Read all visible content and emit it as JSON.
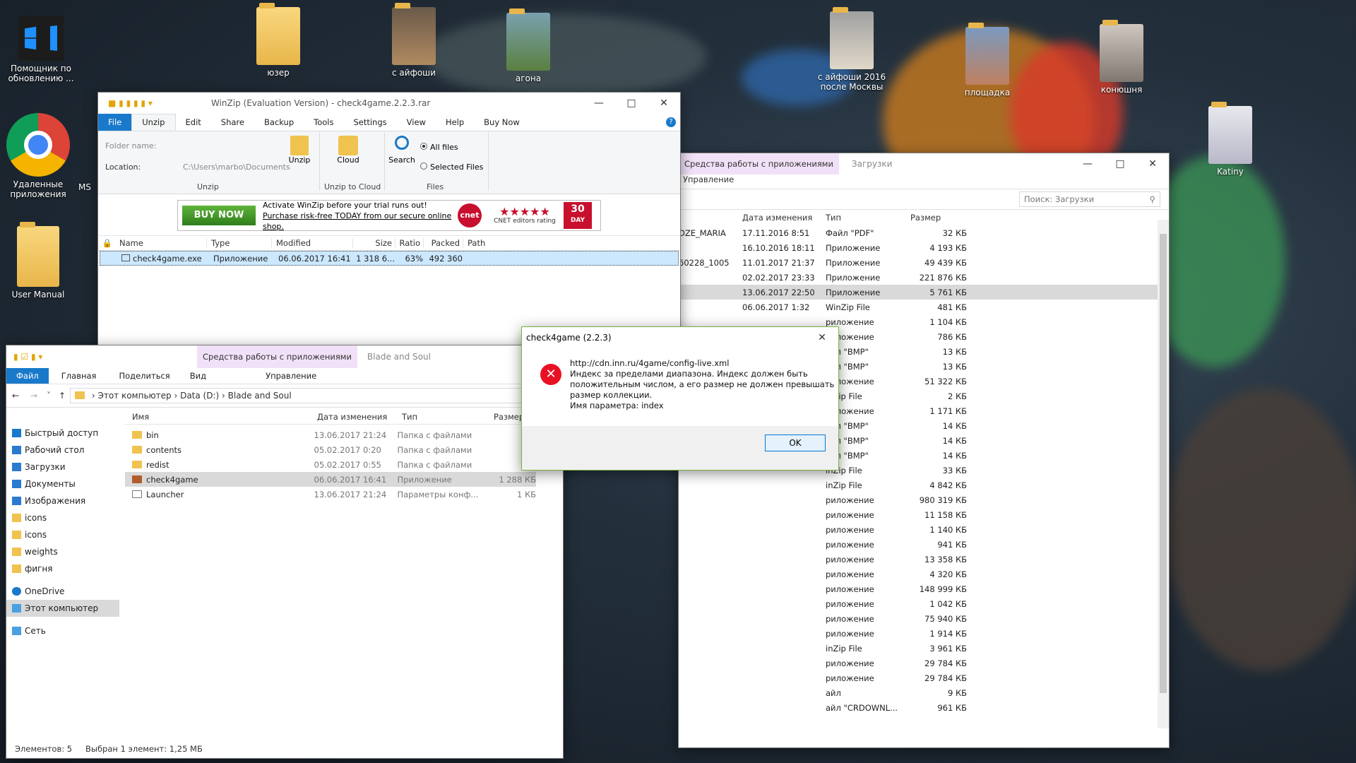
{
  "desktop": {
    "icons": [
      {
        "label": "Помощник по обновлению ...",
        "name": "update-assistant-icon"
      },
      {
        "label": "Удаленные приложения",
        "name": "chrome-icon"
      },
      {
        "label": "MS",
        "name": "ms-icon"
      },
      {
        "label": "User Manual",
        "name": "user-manual-icon"
      },
      {
        "label": "юзер",
        "name": "folder-user-icon"
      },
      {
        "label": "с айфоши",
        "name": "folder-iphone-icon"
      },
      {
        "label": "агона",
        "name": "folder-agona-icon"
      },
      {
        "label": "с айфоши 2016 после Москвы",
        "name": "folder-iphone2016-icon"
      },
      {
        "label": "площадка",
        "name": "folder-playground-icon"
      },
      {
        "label": "конюшня",
        "name": "folder-stable-icon"
      },
      {
        "label": "Katiny",
        "name": "folder-katiny-icon"
      }
    ]
  },
  "winzip": {
    "title": "WinZip (Evaluation Version) - check4game.2.2.3.rar",
    "tabs": [
      "File",
      "Unzip",
      "Edit",
      "Share",
      "Backup",
      "Tools",
      "Settings",
      "View",
      "Help",
      "Buy Now"
    ],
    "folder_name_label": "Folder name:",
    "location_label": "Location:",
    "location_value": "C:\\Users\\marbo\\Documents",
    "unzip_btn": "Unzip",
    "cloud_btn": "Cloud",
    "search_btn": "Search",
    "all_files": "All files",
    "selected_files": "Selected Files",
    "group_unzip": "Unzip",
    "group_cloud": "Unzip to Cloud",
    "group_files": "Files",
    "banner_buy": "BUY NOW",
    "banner_line1": "Activate WinZip before your trial runs out!",
    "banner_line2": "Purchase risk-free TODAY from our secure online shop.",
    "banner_cnet": "cnet",
    "banner_rating": "CNET editors rating",
    "banner_30": "30",
    "banner_day": "DAY",
    "columns": [
      "Name",
      "Type",
      "Modified",
      "Size",
      "Ratio",
      "Packed",
      "Path"
    ],
    "row": [
      "check4game.exe",
      "Приложение",
      "06.06.2017 16:41",
      "1 318 6...",
      "63%",
      "492 360",
      ""
    ]
  },
  "explorer_right": {
    "ctx_tab": "Средства работы с приложениями",
    "downloads_tab": "Загрузки",
    "manage": "Управление",
    "search_placeholder": "Поиск: Загрузки",
    "columns": [
      "Дата изменения",
      "Тип",
      "Размер"
    ],
    "rows": [
      [
        "DZE_MARIA",
        "17.11.2016 8:51",
        "Файл \"PDF\"",
        "32 КБ"
      ],
      [
        "",
        "16.10.2016 18:11",
        "Приложение",
        "4 193 КБ"
      ],
      [
        "60228_1005",
        "11.01.2017 21:37",
        "Приложение",
        "49 439 КБ"
      ],
      [
        "",
        "02.02.2017 23:33",
        "Приложение",
        "221 876 КБ"
      ],
      [
        "",
        "13.06.2017 22:50",
        "Приложение",
        "5 761 КБ"
      ],
      [
        "",
        "06.06.2017 1:32",
        "WinZip File",
        "481 КБ"
      ],
      [
        "",
        "",
        "риложение",
        "1 104 КБ"
      ],
      [
        "",
        "",
        "риложение",
        "786 КБ"
      ],
      [
        "",
        "",
        "айл \"BMP\"",
        "13 КБ"
      ],
      [
        "",
        "",
        "айл \"BMP\"",
        "13 КБ"
      ],
      [
        "",
        "",
        "риложение",
        "51 322 КБ"
      ],
      [
        "",
        "",
        "inZip File",
        "2 КБ"
      ],
      [
        "",
        "",
        "риложение",
        "1 171 КБ"
      ],
      [
        "",
        "",
        "айл \"BMP\"",
        "14 КБ"
      ],
      [
        "",
        "",
        "айл \"BMP\"",
        "14 КБ"
      ],
      [
        "",
        "",
        "айл \"BMP\"",
        "14 КБ"
      ],
      [
        "",
        "",
        "inZip File",
        "33 КБ"
      ],
      [
        "",
        "",
        "inZip File",
        "4 842 КБ"
      ],
      [
        "",
        "",
        "риложение",
        "980 319 КБ"
      ],
      [
        "",
        "",
        "риложение",
        "11 158 КБ"
      ],
      [
        "",
        "",
        "риложение",
        "1 140 КБ"
      ],
      [
        "",
        "",
        "риложение",
        "941 КБ"
      ],
      [
        "",
        "",
        "риложение",
        "13 358 КБ"
      ],
      [
        "",
        "",
        "риложение",
        "4 320 КБ"
      ],
      [
        "",
        "",
        "риложение",
        "148 999 КБ"
      ],
      [
        "",
        "",
        "риложение",
        "1 042 КБ"
      ],
      [
        "",
        "",
        "риложение",
        "75 940 КБ"
      ],
      [
        "",
        "",
        "риложение",
        "1 914 КБ"
      ],
      [
        "",
        "",
        "inZip File",
        "3 961 КБ"
      ],
      [
        "",
        "",
        "риложение",
        "29 784 КБ"
      ],
      [
        "",
        "",
        "риложение",
        "29 784 КБ"
      ],
      [
        "",
        "",
        "айл",
        "9 КБ"
      ],
      [
        "",
        "",
        "айл \"CRDOWNL...",
        "961 КБ"
      ]
    ]
  },
  "explorer_left": {
    "ctx_tab": "Средства работы с приложениями",
    "title": "Blade and Soul",
    "tabs": [
      "Файл",
      "Главная",
      "Поделиться",
      "Вид"
    ],
    "manage": "Управление",
    "breadcrumb": [
      "Этот компьютер",
      "Data (D:)",
      "Blade and Soul"
    ],
    "nav": [
      {
        "label": "Быстрый доступ",
        "name": "nav-quick-access"
      },
      {
        "label": "Рабочий стол",
        "name": "nav-desktop"
      },
      {
        "label": "Загрузки",
        "name": "nav-downloads"
      },
      {
        "label": "Документы",
        "name": "nav-documents"
      },
      {
        "label": "Изображения",
        "name": "nav-pictures"
      },
      {
        "label": "icons",
        "name": "nav-icons-1"
      },
      {
        "label": "icons",
        "name": "nav-icons-2"
      },
      {
        "label": "weights",
        "name": "nav-weights"
      },
      {
        "label": "фигня",
        "name": "nav-junk"
      },
      {
        "label": "OneDrive",
        "name": "nav-onedrive"
      },
      {
        "label": "Этот компьютер",
        "name": "nav-this-pc"
      },
      {
        "label": "Сеть",
        "name": "nav-network"
      }
    ],
    "columns": [
      "Имя",
      "Дата изменения",
      "Тип",
      "Размер"
    ],
    "rows": [
      [
        "bin",
        "13.06.2017 21:24",
        "Папка с файлами",
        ""
      ],
      [
        "contents",
        "05.02.2017 0:20",
        "Папка с файлами",
        ""
      ],
      [
        "redist",
        "05.02.2017 0:55",
        "Папка с файлами",
        ""
      ],
      [
        "check4game",
        "06.06.2017 16:41",
        "Приложение",
        "1 288 КБ"
      ],
      [
        "Launcher",
        "13.06.2017 21:24",
        "Параметры конф...",
        "1 КБ"
      ]
    ],
    "status_count": "Элементов: 5",
    "status_selected": "Выбран 1 элемент: 1,25 МБ"
  },
  "dialog": {
    "title": "check4game (2.2.3)",
    "url": "http://cdn.inn.ru/4game/config-live.xml",
    "line1": "Индекс за пределами диапазона. Индекс должен быть",
    "line2": "положительным числом, а его размер не должен превышать",
    "line3": "размер коллекции.",
    "line4": "Имя параметра: index",
    "ok": "OK"
  }
}
